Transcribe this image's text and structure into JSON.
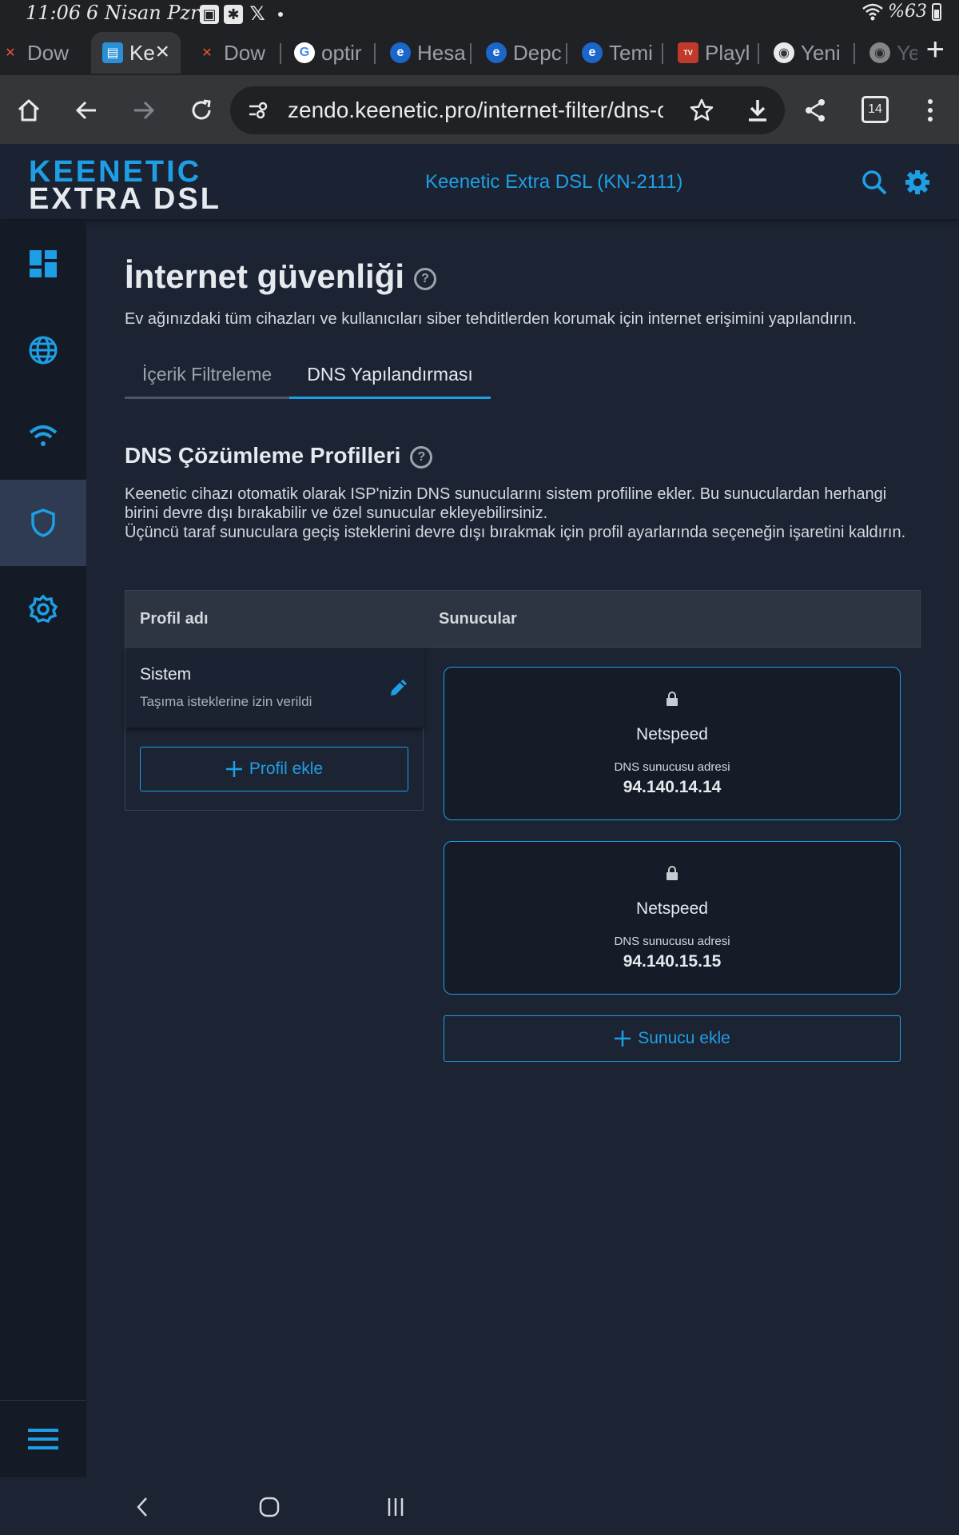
{
  "status": {
    "time": "11:06",
    "date": "6 Nisan Pzr",
    "battery": "%63"
  },
  "tabs": [
    {
      "label": "Dow",
      "favicon": "x-icon",
      "active": false
    },
    {
      "label": "Ke",
      "favicon": "keenetic-icon",
      "active": true
    },
    {
      "label": "Dow",
      "favicon": "x-icon",
      "active": false
    },
    {
      "label": "optir",
      "favicon": "google-icon",
      "active": false
    },
    {
      "label": "Hesa",
      "favicon": "e-icon",
      "active": false
    },
    {
      "label": "Depc",
      "favicon": "e-icon",
      "active": false
    },
    {
      "label": "Temi",
      "favicon": "e-icon",
      "active": false
    },
    {
      "label": "Playl",
      "favicon": "iptv-icon",
      "active": false
    },
    {
      "label": "Yeni",
      "favicon": "chrome-icon",
      "active": false
    },
    {
      "label": "Yeni",
      "favicon": "chrome-icon",
      "active": false
    }
  ],
  "browser": {
    "url": "zendo.keenetic.pro/internet-filter/dns-c",
    "tab_count": "14"
  },
  "app": {
    "logo_top": "KEENETIC",
    "logo_bottom": "EXTRA DSL",
    "device_name": "Keenetic Extra DSL (KN-2111)"
  },
  "page": {
    "title": "İnternet güvenliği",
    "description": "Ev ağınızdaki tüm cihazları ve kullanıcıları siber tehditlerden korumak için internet erişimini yapılandırın.",
    "tabs": [
      "İçerik Filtreleme",
      "DNS Yapılandırması"
    ]
  },
  "section": {
    "title": "DNS Çözümleme Profilleri",
    "desc_line1": "Keenetic cihazı otomatik olarak ISP'nizin DNS sunucularını sistem profiline ekler. Bu sunuculardan herhangi birini devre dışı bırakabilir ve özel sunucular ekleyebilirsiniz.",
    "desc_line2": "Üçüncü taraf sunuculara geçiş isteklerini devre dışı bırakmak için profil ayarlarında seçeneğin işaretini kaldırın."
  },
  "table": {
    "col_profile": "Profil adı",
    "col_servers": "Sunucular",
    "profile": {
      "name": "Sistem",
      "subtitle": "Taşıma isteklerine izin verildi"
    },
    "add_profile": "Profil ekle",
    "servers": [
      {
        "name": "Netspeed",
        "label": "DNS sunucusu adresi",
        "address": "94.140.14.14"
      },
      {
        "name": "Netspeed",
        "label": "DNS sunucusu adresi",
        "address": "94.140.15.15"
      }
    ],
    "add_server": "Sunucu ekle"
  },
  "colors": {
    "accent": "#1e9fe5",
    "background": "#1c2433",
    "sidebar": "#141b27",
    "sidebar_active": "#2e3b52"
  }
}
